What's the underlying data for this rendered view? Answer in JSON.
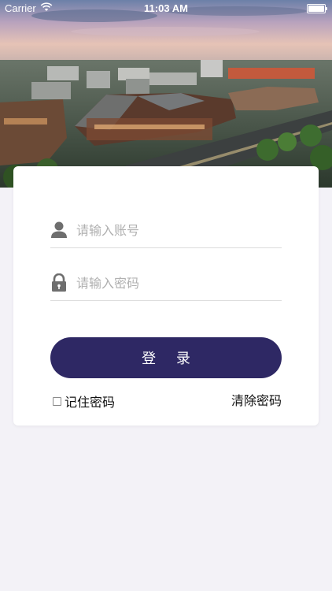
{
  "status_bar": {
    "carrier": "Carrier",
    "time": "11:03 AM"
  },
  "hero": {
    "description_icon": "aerial-city-rendering-image"
  },
  "login": {
    "account_placeholder": "请输入账号",
    "password_placeholder": "请输入密码",
    "login_button": "登 录",
    "remember_password": "记住密码",
    "clear_password": "清除密码"
  },
  "colors": {
    "primary": "#2e2864",
    "background": "#f3f2f7",
    "card": "#ffffff",
    "placeholder": "#b0b0b0"
  },
  "icons": {
    "account": "user-icon",
    "password": "lock-icon",
    "wifi": "wifi-icon",
    "battery": "battery-icon"
  }
}
